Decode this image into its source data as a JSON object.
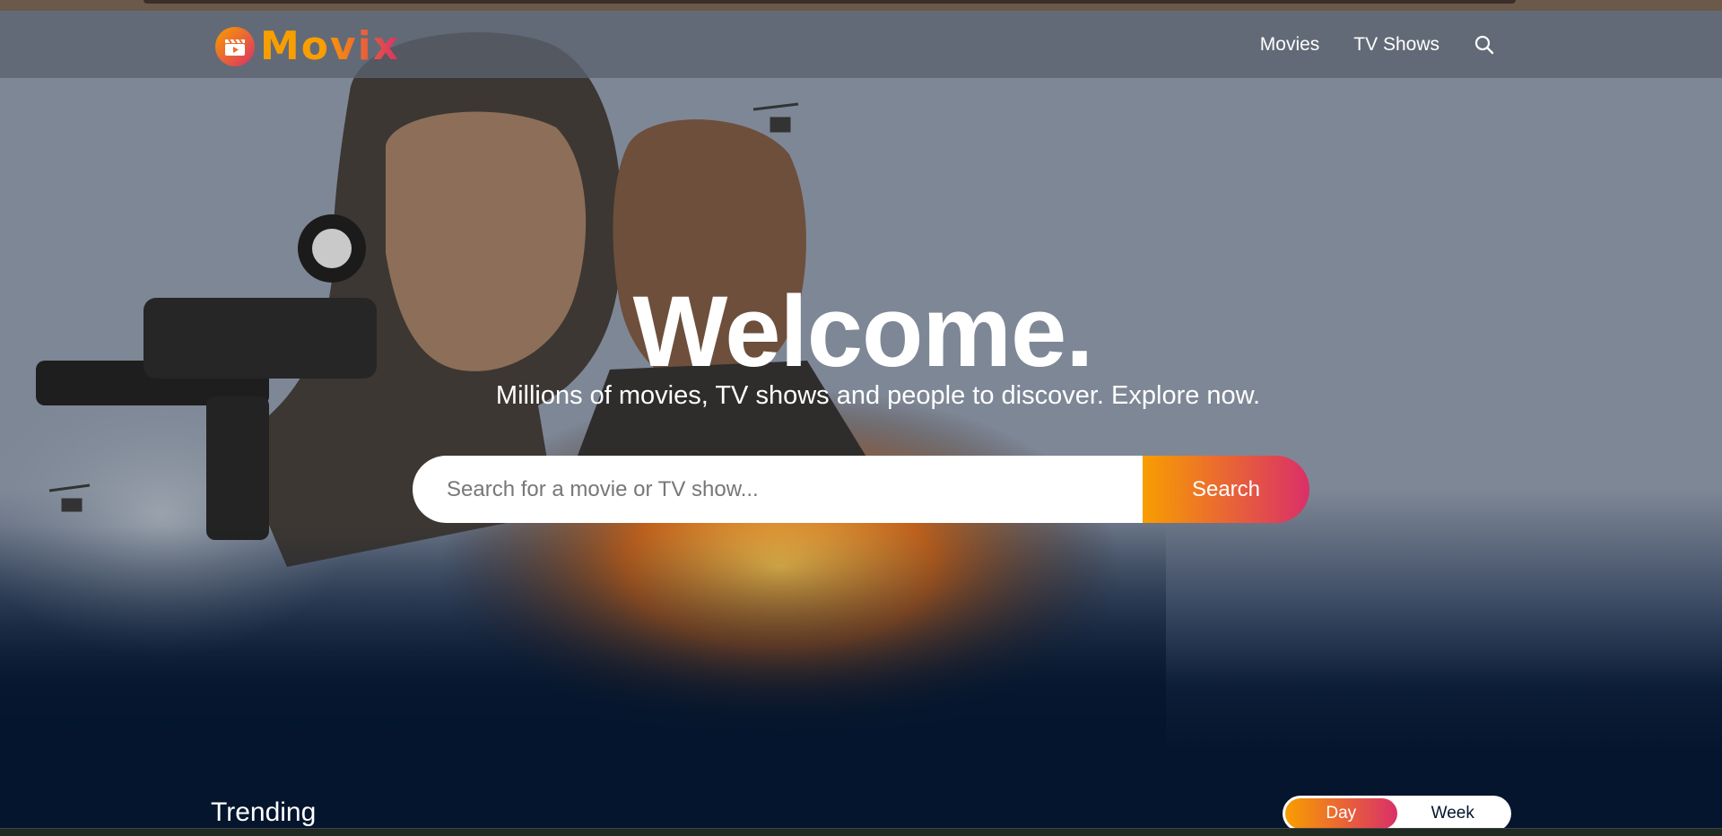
{
  "topbar": {
    "logo_text": "Movix",
    "nav": [
      {
        "label": "Movies"
      },
      {
        "label": "TV Shows"
      }
    ],
    "search_icon": "search-icon"
  },
  "hero": {
    "title": "Welcome.",
    "subtitle": "Millions of movies, TV shows and people to discover. Explore now.",
    "search_placeholder": "Search for a movie or TV show...",
    "search_button": "Search"
  },
  "trending": {
    "title": "Trending",
    "tabs": [
      {
        "label": "Day",
        "active": true
      },
      {
        "label": "Week",
        "active": false
      }
    ]
  },
  "colors": {
    "accent_orange": "#f89e00",
    "accent_pink": "#da2f68",
    "background_dark": "#04152d"
  }
}
